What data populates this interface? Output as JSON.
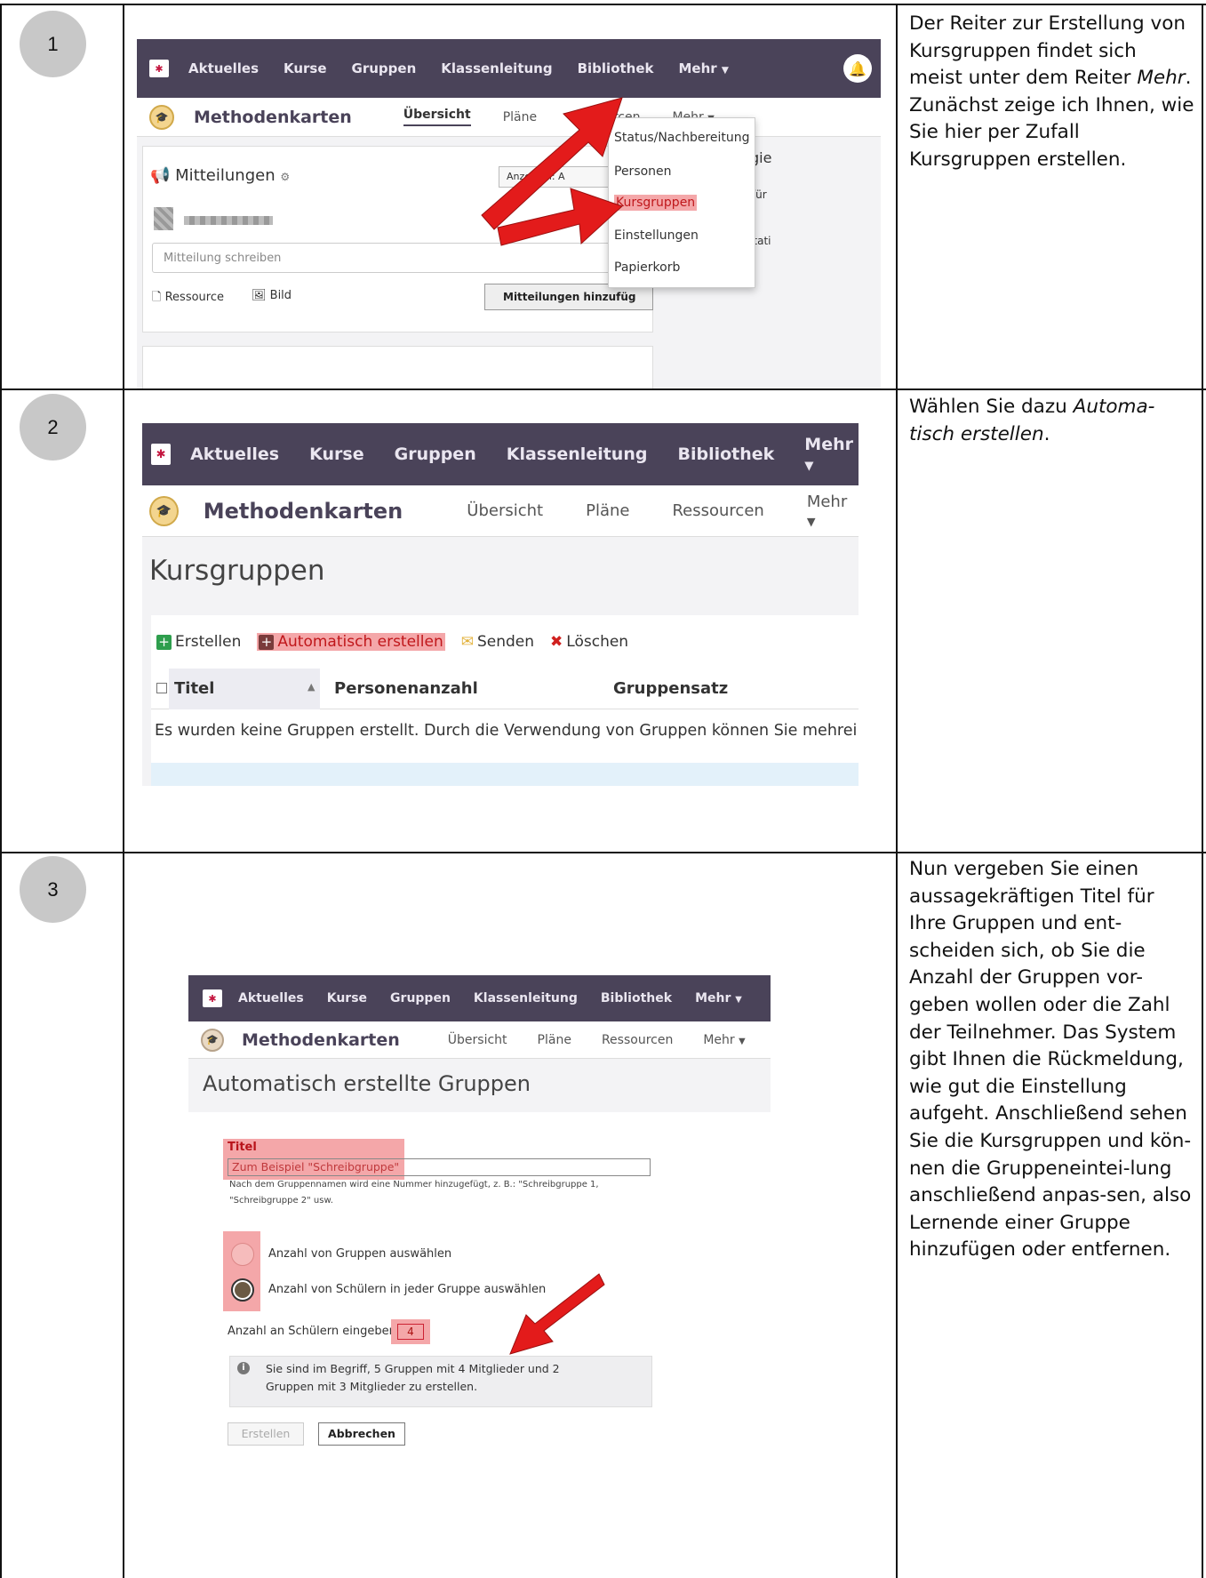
{
  "steps": [
    {
      "number": "1",
      "instruction_html": "Der Reiter zur Erstellung von Kursgruppen findet sich meist unter dem Reiter <i>Mehr</i>.<br>Zunächst zeige ich Ihnen, wie Sie hier per Zufall Kursgruppen erstellen.",
      "screenshot": {
        "nav": [
          "Aktuelles",
          "Kurse",
          "Gruppen",
          "Klassenleitung",
          "Bibliothek",
          "Mehr"
        ],
        "course": "Methodenkarten",
        "tabs": [
          "Übersicht",
          "Pläne",
          "Ressourcen",
          "Mehr"
        ],
        "panel_title": "Mitteilungen",
        "anzeigen": "Anzeigen: A",
        "input_placeholder": "Mitteilung schreiben",
        "attach_resource": "Ressource",
        "attach_image": "Bild",
        "submit": "Mitteilungen hinzufüg",
        "menu": [
          "Status/Nachbereitung",
          "Personen",
          "Kursgruppen",
          "Einstellungen",
          "Papierkorb"
        ],
        "right_cut": [
          "gie",
          ": für",
          "etati"
        ]
      }
    },
    {
      "number": "2",
      "instruction_html": "Wählen Sie dazu <i>Automa-tisch erstellen</i>.",
      "screenshot": {
        "nav": [
          "Aktuelles",
          "Kurse",
          "Gruppen",
          "Klassenleitung",
          "Bibliothek",
          "Mehr"
        ],
        "course": "Methodenkarten",
        "tabs": [
          "Übersicht",
          "Pläne",
          "Ressourcen",
          "Mehr"
        ],
        "page_title": "Kursgruppen",
        "actions": [
          "Erstellen",
          "Automatisch erstellen",
          "Senden",
          "Löschen"
        ],
        "columns": [
          "Titel",
          "Personenanzahl",
          "Gruppensatz"
        ],
        "empty_text": "Es wurden keine Gruppen erstellt. Durch die Verwendung von Gruppen können Sie mehrei"
      }
    },
    {
      "number": "3",
      "instruction_html": "Nun vergeben Sie einen aussagekräftigen Titel für Ihre Gruppen und ent-scheiden sich, ob Sie die Anzahl der Gruppen vor-geben wollen oder die Zahl der Teilnehmer. Das System gibt Ihnen die Rückmeldung, wie gut die Einstellung aufgeht. Anschließend sehen Sie die Kursgruppen und kön-nen die Gruppeneintei-lung anschließend anpas-sen, also Lernende einer Gruppe hinzufügen oder entfernen.",
      "screenshot": {
        "nav": [
          "Aktuelles",
          "Kurse",
          "Gruppen",
          "Klassenleitung",
          "Bibliothek",
          "Mehr"
        ],
        "course": "Methodenkarten",
        "tabs": [
          "Übersicht",
          "Pläne",
          "Ressourcen",
          "Mehr"
        ],
        "page_title": "Automatisch erstellte Gruppen",
        "title_label": "Titel",
        "title_placeholder": "Zum Beispiel \"Schreibgruppe\"",
        "title_hint_1": "Nach dem Gruppennamen wird eine Nummer hinzugefügt, z. B.: \"Schreibgruppe 1,",
        "title_hint_2": "\"Schreibgruppe 2\" usw.",
        "radio_1": "Anzahl von Gruppen auswählen",
        "radio_2": "Anzahl von Schülern in jeder Gruppe auswählen",
        "count_label": "Anzahl an Schülern eingeben",
        "count_value": "4",
        "info_1": "Sie sind im Begriff, 5 Gruppen mit 4 Mitglieder und 2",
        "info_2": "Gruppen mit 3 Mitglieder zu erstellen.",
        "btn_create": "Erstellen",
        "btn_cancel": "Abbrechen"
      }
    }
  ],
  "colors": {
    "nav_bg": "#4a4359",
    "highlight": "#f4a7a9",
    "arrow": "#e31b1b",
    "badge": "#c8c8c8"
  }
}
